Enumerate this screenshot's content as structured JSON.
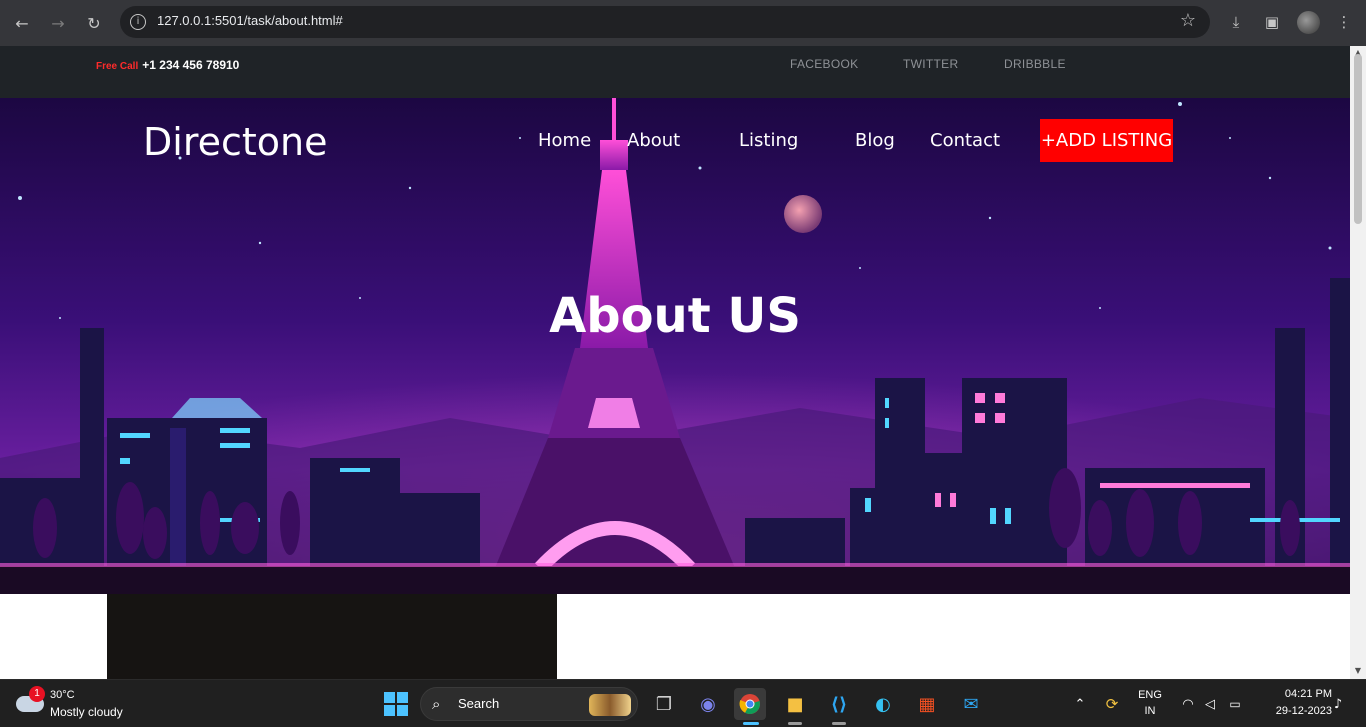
{
  "browser": {
    "url": "127.0.0.1:5501/task/about.html#"
  },
  "topbar": {
    "free_call_label": "Free Call",
    "phone": "+1 234 456 78910",
    "social": [
      "FACEBOOK",
      "TWITTER",
      "DRIBBBLE"
    ]
  },
  "header": {
    "logo": "Directone",
    "menu": [
      "Home",
      "About",
      "Listing",
      "Blog",
      "Contact"
    ],
    "cta": "+ADD LISTING"
  },
  "hero": {
    "title": "About US"
  },
  "taskbar": {
    "weather_badge": "1",
    "temperature": "30°C",
    "condition": "Mostly cloudy",
    "search_label": "Search",
    "language": "ENG",
    "region": "IN",
    "time": "04:21 PM",
    "date": "29-12-2023"
  },
  "colors": {
    "topbar_bg": "#1f2327",
    "cta_bg": "#ff0000",
    "free_call": "#ff2b2b",
    "hero_sky": "#2a0a5e"
  }
}
